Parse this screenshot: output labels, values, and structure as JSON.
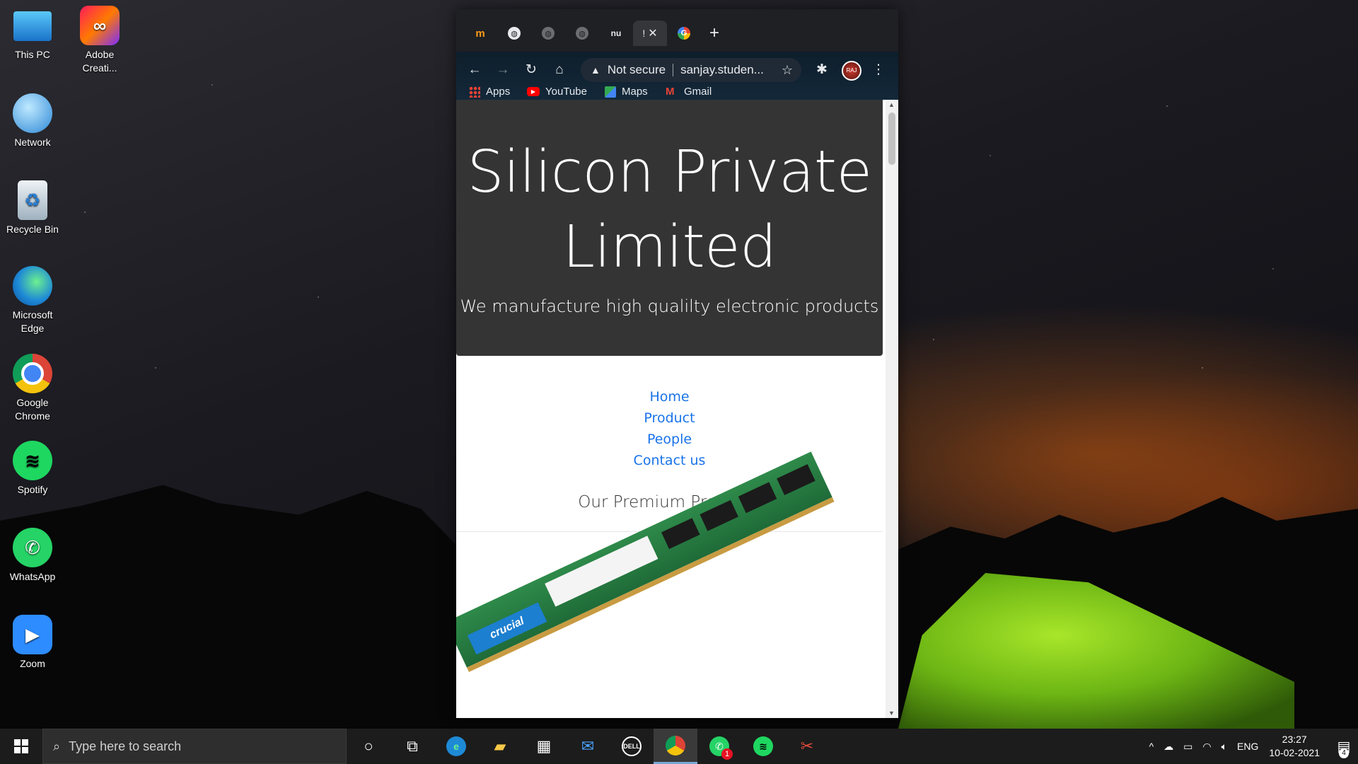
{
  "desktop": {
    "icons": [
      {
        "label": "This PC"
      },
      {
        "label": "Adobe Creati..."
      },
      {
        "label": "Network"
      },
      {
        "label": "Recycle Bin"
      },
      {
        "label": "Microsoft Edge"
      },
      {
        "label": "Google Chrome"
      },
      {
        "label": "Spotify"
      },
      {
        "label": "WhatsApp"
      },
      {
        "label": "Zoom"
      }
    ]
  },
  "browser": {
    "tabs": [
      {
        "favicon": "m-icon",
        "text": "m"
      },
      {
        "favicon": "globe-icon",
        "text": ""
      },
      {
        "favicon": "globe-icon",
        "text": ""
      },
      {
        "favicon": "globe-icon",
        "text": ""
      },
      {
        "favicon": "nu-icon",
        "text": "nu"
      },
      {
        "favicon": "active-tab",
        "text": "!"
      },
      {
        "favicon": "google-icon",
        "text": "G"
      }
    ],
    "address": {
      "security": "Not secure",
      "url": "sanjay.studen..."
    },
    "bookmarks": [
      {
        "label": "Apps",
        "icon": "apps-grid-icon"
      },
      {
        "label": "YouTube",
        "icon": "youtube-icon"
      },
      {
        "label": "Maps",
        "icon": "maps-icon"
      },
      {
        "label": "Gmail",
        "icon": "gmail-icon"
      }
    ],
    "profile_initials": "RAJ"
  },
  "page": {
    "hero": {
      "title_line1": "Silicon Private",
      "title_line2": "Limited",
      "subtitle": "We manufacture high qualilty electronic products"
    },
    "nav": [
      "Home",
      "Product",
      "People",
      "Contact us"
    ],
    "section_title": "Our Premium Products",
    "product_label": "crucial"
  },
  "taskbar": {
    "search_placeholder": "Type here to search",
    "whatsapp_badge": "1",
    "language": "ENG",
    "time": "23:27",
    "date": "10-02-2021",
    "notification_count": "4"
  }
}
